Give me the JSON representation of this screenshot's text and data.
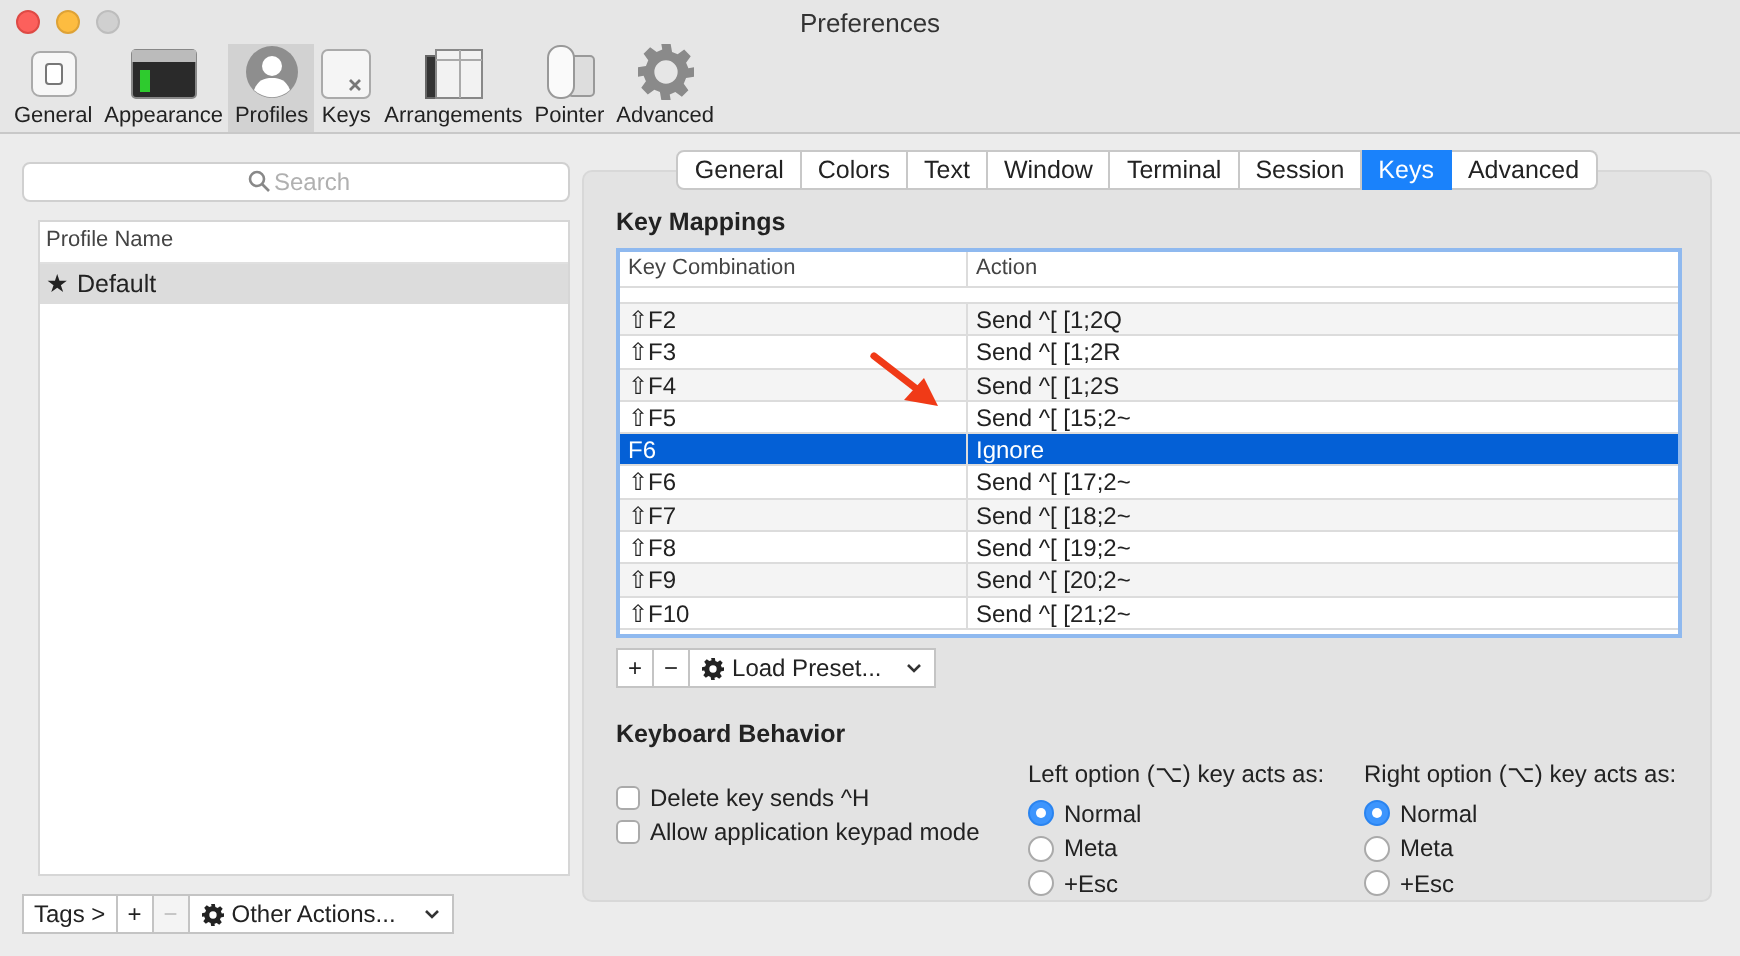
{
  "window": {
    "title": "Preferences"
  },
  "toolbar": [
    {
      "label": "General",
      "selected": false
    },
    {
      "label": "Appearance",
      "selected": false
    },
    {
      "label": "Profiles",
      "selected": true
    },
    {
      "label": "Keys",
      "selected": false
    },
    {
      "label": "Arrangements",
      "selected": false
    },
    {
      "label": "Pointer",
      "selected": false
    },
    {
      "label": "Advanced",
      "selected": false
    }
  ],
  "profiles": {
    "search": {
      "placeholder": "Search"
    },
    "column": "Profile Name",
    "rows": [
      {
        "name": "★ Default",
        "selected": true
      }
    ],
    "buttons": [
      {
        "label": "Tags >",
        "disabled": false
      },
      {
        "label": "+",
        "disabled": false
      },
      {
        "label": "−",
        "disabled": true
      }
    ],
    "actions_menu": "Other Actions..."
  },
  "tabs": [
    {
      "label": "General",
      "selected": false
    },
    {
      "label": "Colors",
      "selected": false
    },
    {
      "label": "Text",
      "selected": false
    },
    {
      "label": "Window",
      "selected": false
    },
    {
      "label": "Terminal",
      "selected": false
    },
    {
      "label": "Session",
      "selected": false
    },
    {
      "label": "Keys",
      "selected": true
    },
    {
      "label": "Advanced",
      "selected": false
    }
  ],
  "key_mappings": {
    "title": "Key Mappings",
    "columns": [
      "Key Combination",
      "Action"
    ],
    "rows": [
      {
        "key": "⇧F2",
        "action": "Send ^[ [1;2Q",
        "selected": false
      },
      {
        "key": "⇧F3",
        "action": "Send ^[ [1;2R",
        "selected": false
      },
      {
        "key": "⇧F4",
        "action": "Send ^[ [1;2S",
        "selected": false
      },
      {
        "key": "⇧F5",
        "action": "Send ^[ [15;2~",
        "selected": false
      },
      {
        "key": "F6",
        "action": "Ignore",
        "selected": true
      },
      {
        "key": "⇧F6",
        "action": "Send ^[ [17;2~",
        "selected": false
      },
      {
        "key": "⇧F7",
        "action": "Send ^[ [18;2~",
        "selected": false
      },
      {
        "key": "⇧F8",
        "action": "Send ^[ [19;2~",
        "selected": false
      },
      {
        "key": "⇧F9",
        "action": "Send ^[ [20;2~",
        "selected": false
      },
      {
        "key": "⇧F10",
        "action": "Send ^[ [21;2~",
        "selected": false
      }
    ],
    "buttons": [
      "+",
      "−"
    ],
    "preset_menu": "Load Preset..."
  },
  "keyboard_behavior": {
    "title": "Keyboard Behavior",
    "checkboxes": [
      {
        "label": "Delete key sends ^H",
        "checked": false
      },
      {
        "label": "Allow application keypad mode",
        "checked": false
      }
    ],
    "option_groups": [
      {
        "label": "Left option (⌥) key acts as:",
        "options": [
          {
            "label": "Normal",
            "selected": true
          },
          {
            "label": "Meta",
            "selected": false
          },
          {
            "label": "+Esc",
            "selected": false
          }
        ]
      },
      {
        "label": "Right option (⌥) key acts as:",
        "options": [
          {
            "label": "Normal",
            "selected": true
          },
          {
            "label": "Meta",
            "selected": false
          },
          {
            "label": "+Esc",
            "selected": false
          }
        ]
      }
    ]
  }
}
